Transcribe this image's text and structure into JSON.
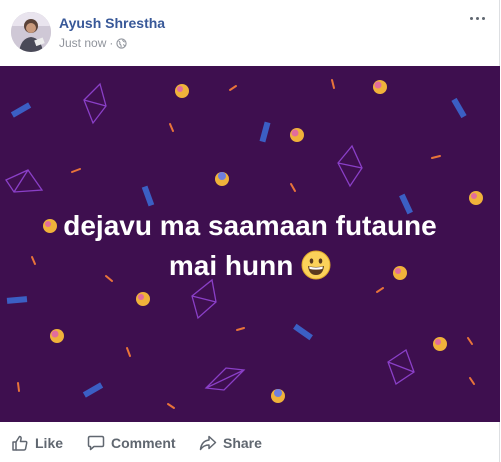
{
  "post": {
    "author": "Ayush Shrestha",
    "timestamp": "Just now",
    "separator": "·",
    "privacy_icon": "globe-icon",
    "text_line1": "dejavu ma saamaan futaune",
    "text_line2": "mai hunn",
    "emoji": "grinning-face",
    "background_color": "#3e0f4f",
    "author_color": "#385898"
  },
  "actions": {
    "like_label": "Like",
    "comment_label": "Comment",
    "share_label": "Share"
  }
}
